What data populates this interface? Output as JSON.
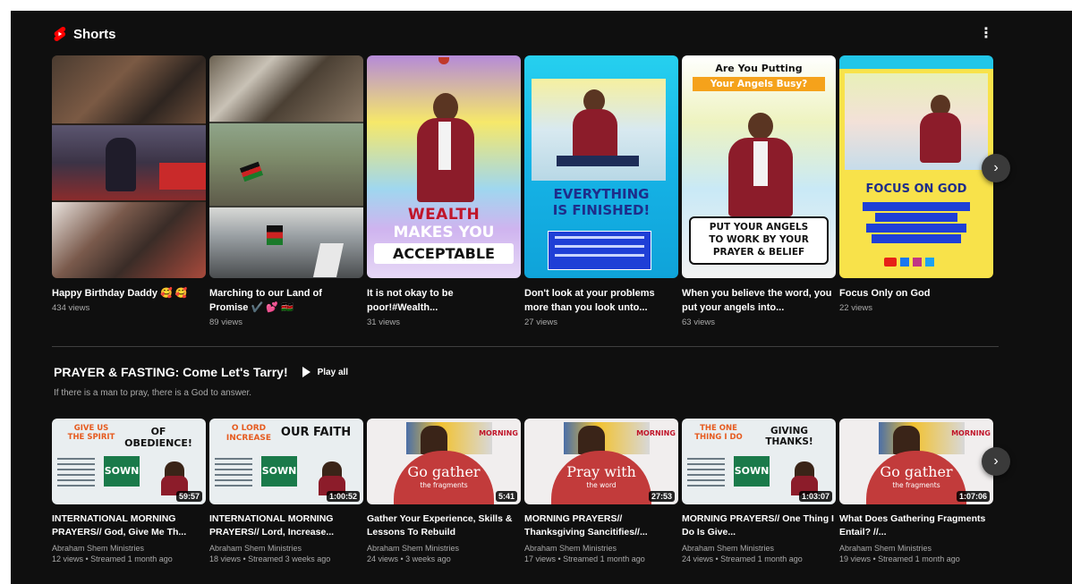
{
  "shorts": {
    "section_title": "Shorts",
    "more_icon": "more-vert-icon",
    "items": [
      {
        "title": "Happy Birthday Daddy 🥰 🥰",
        "views": "434 views"
      },
      {
        "title": "Marching to our Land of Promise ✔️ 💕 🇰🇪",
        "views": "89 views"
      },
      {
        "title": "It is not okay to be poor!#Wealth...",
        "views": "31 views",
        "art": [
          "WEALTH",
          "MAKES YOU",
          "ACCEPTABLE"
        ]
      },
      {
        "title": "Don't look at your problems more than you look unto...",
        "views": "27 views",
        "art": [
          "EVERYTHING",
          "IS FINISHED!"
        ]
      },
      {
        "title": "When you believe the word, you put your angels into...",
        "views": "63 views",
        "art": [
          "Are You Putting",
          "Your Angels Busy?",
          "PUT YOUR ANGELS",
          "TO WORK BY YOUR",
          "PRAYER & BELIEF"
        ]
      },
      {
        "title": "Focus Only on God",
        "views": "22 views",
        "art": [
          "FOCUS ON GOD"
        ]
      }
    ]
  },
  "playlist": {
    "title": "PRAYER & FASTING: Come Let's Tarry!",
    "play_all": "Play all",
    "description": "If there is a man to pray, there is a God to answer.",
    "items": [
      {
        "title": "INTERNATIONAL MORNING PRAYERS// God, Give Me Th...",
        "channel": "Abraham Shem Ministries",
        "meta": "12 views • Streamed 1 month ago",
        "duration": "59:57",
        "art": [
          "GIVE US",
          "THE SPIRIT",
          "OF OBEDIENCE!",
          "SOWN"
        ]
      },
      {
        "title": "INTERNATIONAL MORNING PRAYERS// Lord, Increase...",
        "channel": "Abraham Shem Ministries",
        "meta": "18 views • Streamed 3 weeks ago",
        "duration": "1:00:52",
        "art": [
          "O LORD",
          "INCREASE",
          "OUR FAITH",
          "SOWN"
        ]
      },
      {
        "title": "Gather Your Experience, Skills & Lessons To Rebuild",
        "channel": "Abraham Shem Ministries",
        "meta": "24 views • 3 weeks ago",
        "duration": "5:41",
        "art": [
          "MORNING",
          "Go gather",
          "the fragments"
        ]
      },
      {
        "title": "MORNING PRAYERS// Thanksgiving Sancitifies//...",
        "channel": "Abraham Shem Ministries",
        "meta": "17 views • Streamed 1 month ago",
        "duration": "27:53",
        "art": [
          "MORNING",
          "Pray with",
          "the word"
        ]
      },
      {
        "title": "MORNING PRAYERS// One Thing I Do Is Give...",
        "channel": "Abraham Shem Ministries",
        "meta": "24 views • Streamed 1 month ago",
        "duration": "1:03:07",
        "art": [
          "THE ONE",
          "THING I DO",
          "GIVING THANKS!",
          "SOWN"
        ]
      },
      {
        "title": "What Does Gathering Fragments Entail? //...",
        "channel": "Abraham Shem Ministries",
        "meta": "19 views • Streamed 1 month ago",
        "duration": "1:07:06",
        "art": [
          "MORNING",
          "Go gather",
          "the fragments"
        ]
      }
    ]
  },
  "icons": {
    "next": "chevron-right-icon",
    "play": "play-icon"
  },
  "colors": {
    "background": "#0f0f0f",
    "brand_red": "#ff0000",
    "secondary_text": "#aaaaaa"
  }
}
